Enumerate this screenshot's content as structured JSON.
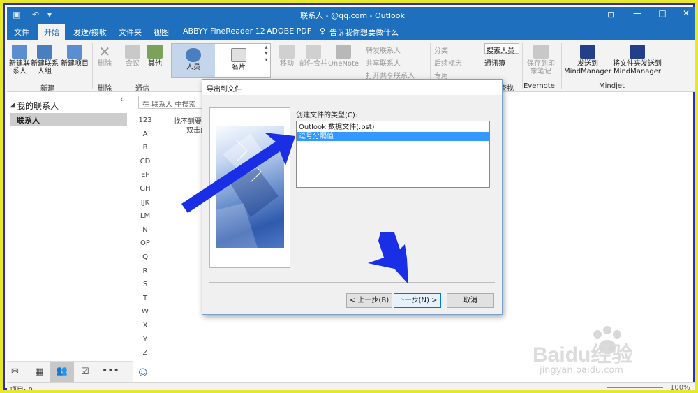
{
  "window": {
    "title": "联系人 - @qq.com - Outlook",
    "minimize": "—",
    "restore": "□",
    "close": "✕"
  },
  "tabs": [
    {
      "label": "文件"
    },
    {
      "label": "开始"
    },
    {
      "label": "发送/接收"
    },
    {
      "label": "文件夹"
    },
    {
      "label": "视图"
    },
    {
      "label": "ABBYY FineReader 12"
    },
    {
      "label": "ADOBE PDF"
    },
    {
      "label": "告诉我你想要做什么"
    }
  ],
  "ribbon": {
    "new_group": {
      "label": "新建",
      "new_contact": "新建联系人",
      "new_group": "新建联系人组",
      "new_items": "新建项目"
    },
    "delete_group": {
      "label": "删除",
      "delete": "删除"
    },
    "comm_group": {
      "label": "通信",
      "meeting": "会议",
      "more": "其他"
    },
    "view_group": {
      "people": "人员",
      "card": "名片"
    },
    "actions_group": {
      "move": "移动",
      "mail_merge": "邮件合并",
      "onenote": "OneNote"
    },
    "share_group": {
      "forward": "转发联系人",
      "share": "共享联系人",
      "open_shared": "打开共享联系人"
    },
    "tags_group": {
      "categorize": "分类",
      "followup": "后续标志",
      "private": "专用"
    },
    "find_group": {
      "search_people": "搜索人员",
      "address_book": "通讯簿",
      "label": "查找"
    },
    "evernote_group": {
      "label": "Evernote",
      "save": "保存到印象笔记"
    },
    "mindjet_group": {
      "label": "Mindjet",
      "send": "发送到MindManager",
      "send_folder": "将文件夹发送到MindManager"
    }
  },
  "sidebar": {
    "section": "我的联系人",
    "items": [
      {
        "label": "联系人"
      }
    ]
  },
  "search": {
    "placeholder": "在 联系人 中搜索"
  },
  "alphabet": [
    "123",
    "A",
    "B",
    "CD",
    "EF",
    "GH",
    "IJK",
    "LM",
    "N",
    "OP",
    "Q",
    "R",
    "S",
    "T",
    "W",
    "X",
    "Y",
    "Z"
  ],
  "list_empty": {
    "line1": "找不到要在",
    "line2": "双击此"
  },
  "statusbar": {
    "items": "项目: 0",
    "zoom": "100%"
  },
  "dialog": {
    "title": "导出到文件",
    "prompt": "创建文件的类型(C):",
    "options": [
      {
        "label": "Outlook 数据文件(.pst)",
        "selected": false
      },
      {
        "label": "逗号分隔值",
        "selected": true
      }
    ],
    "back": "< 上一步(B)",
    "next": "下一步(N) >",
    "cancel": "取消"
  },
  "watermark": {
    "brand": "Baidu经验",
    "url": "jingyan.baidu.com"
  },
  "colors": {
    "accent": "#1e6fbd",
    "selection": "#3399ff",
    "arrow": "#1a2ee6",
    "frame_yellow": "#e8e82a"
  }
}
